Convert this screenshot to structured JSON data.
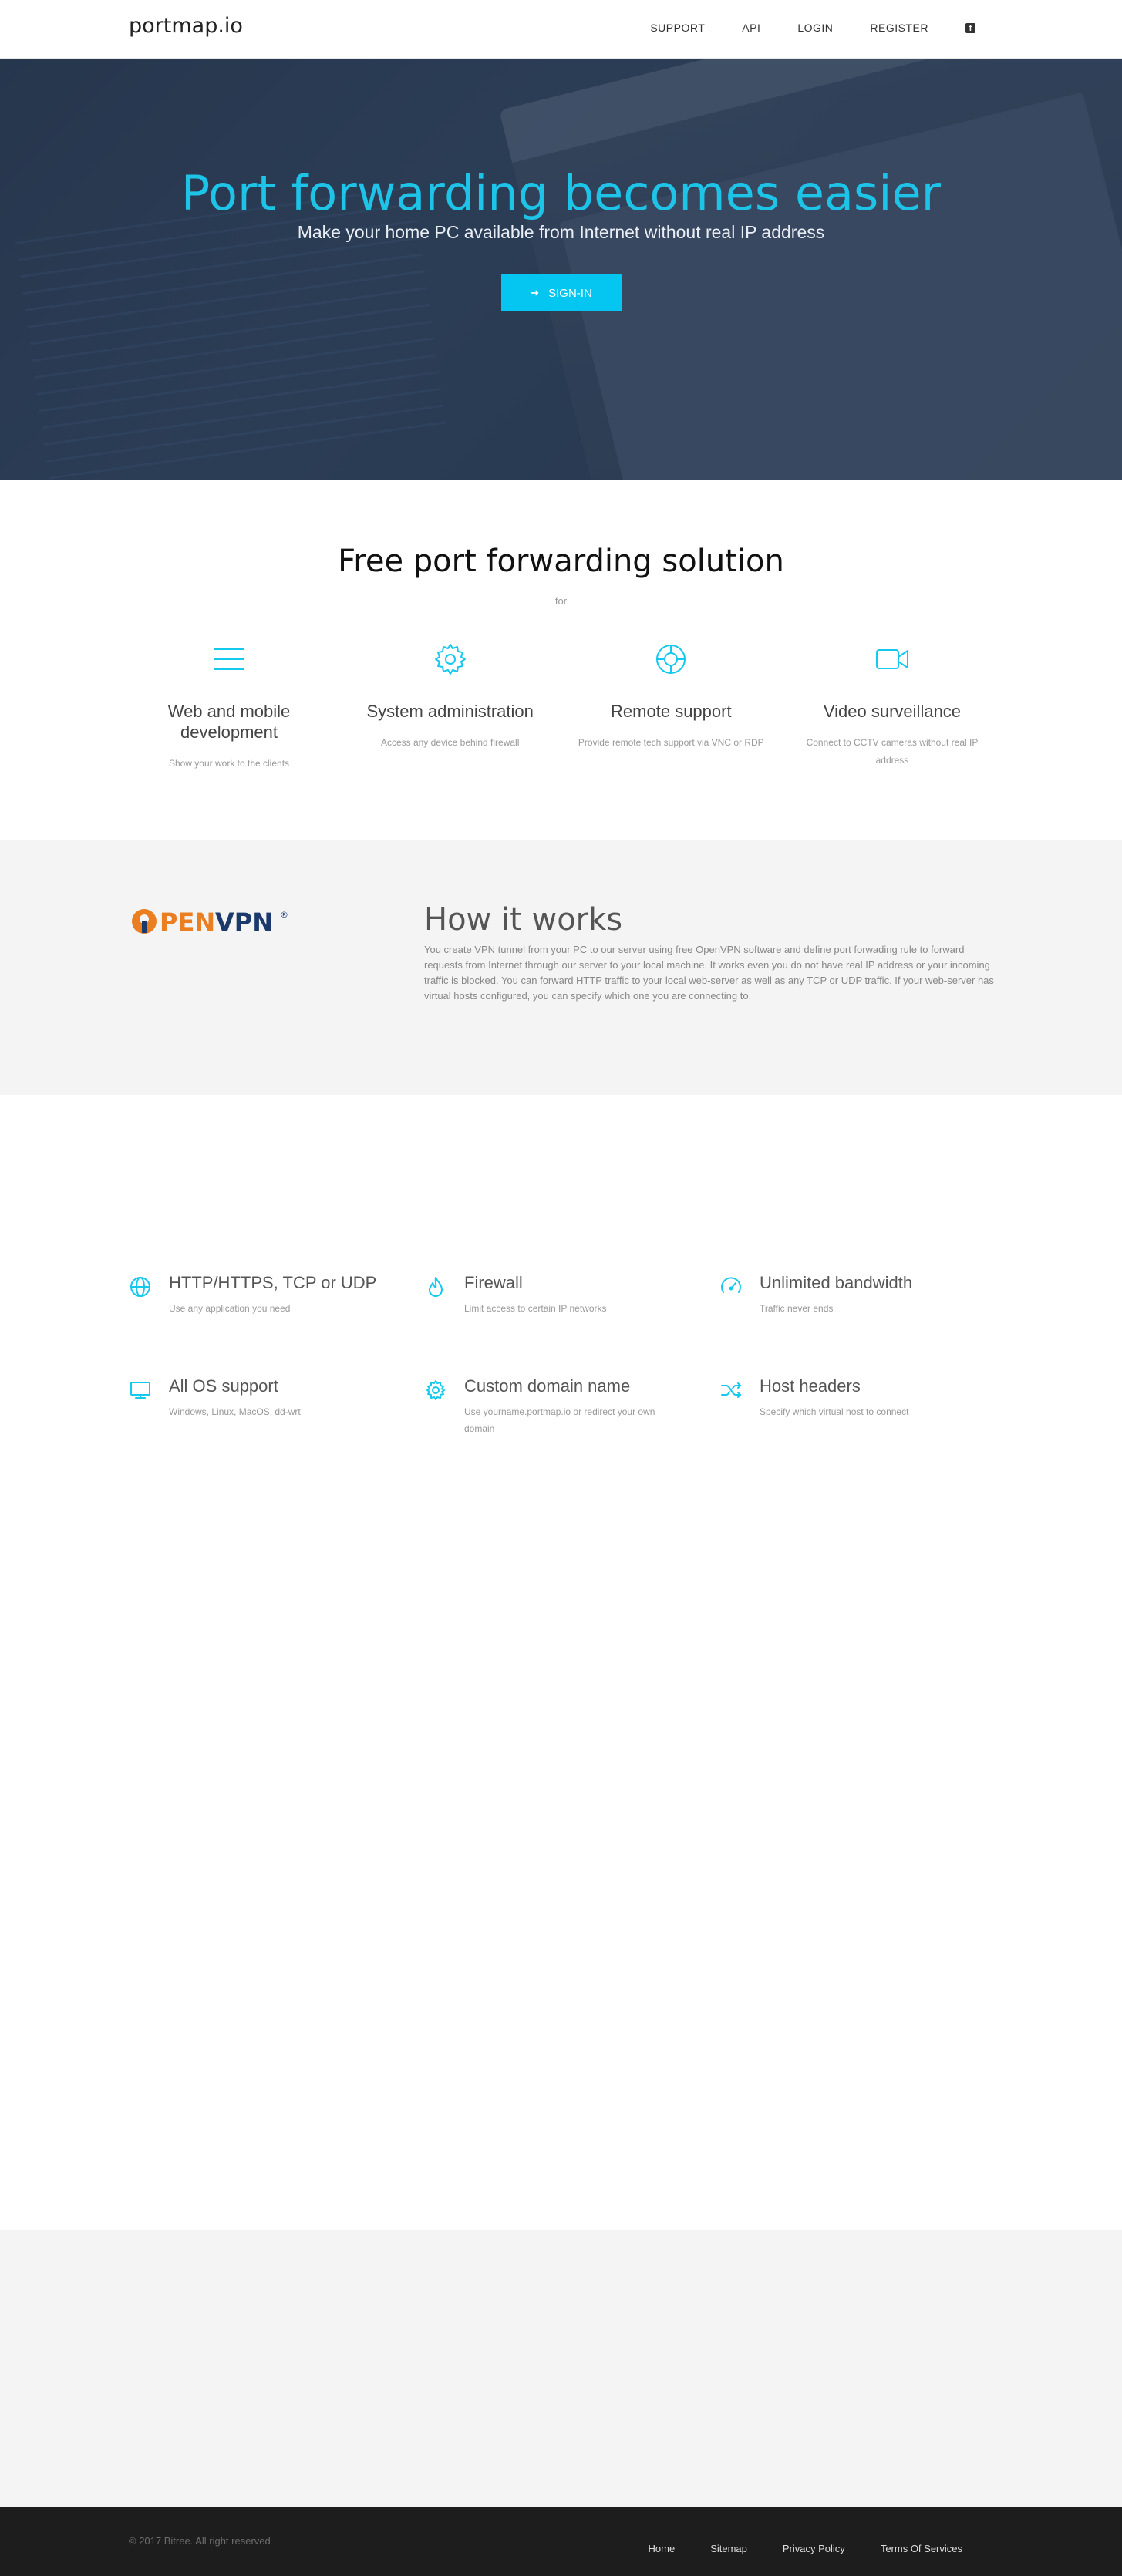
{
  "nav": {
    "brand": "portmap.io",
    "links": [
      "SUPPORT",
      "API",
      "LOGIN",
      "REGISTER"
    ],
    "facebook_glyph": "f"
  },
  "hero": {
    "title": "Port forwarding becomes easier",
    "subtitle": "Make your home PC available from Internet without real IP address",
    "button": "SIGN-IN"
  },
  "solutions": {
    "title": "Free port forwarding solution",
    "for": "for",
    "items": [
      {
        "icon": "menu-icon",
        "title": "Web and mobile development",
        "desc": "Show your work to the clients"
      },
      {
        "icon": "gear-icon",
        "title": "System administration",
        "desc": "Access any device behind firewall"
      },
      {
        "icon": "lifebuoy-icon",
        "title": "Remote support",
        "desc": "Provide remote tech support via VNC or RDP"
      },
      {
        "icon": "video-camera-icon",
        "title": "Video surveillance",
        "desc": "Connect to CCTV cameras without real IP address"
      }
    ]
  },
  "how": {
    "logo_o": "O",
    "logo_pen": "PEN",
    "logo_vpn": "VPN",
    "logo_reg": "®",
    "title": "How it works",
    "text": "You create VPN tunnel from your PC to our server using free OpenVPN software and define port forwading rule to forward requests from Internet through our server to your local machine. It works even you do not have real IP address or your incoming traffic is blocked. You can forward HTTP traffic to your local web-server as well as any TCP or UDP traffic. If your web-server has virtual hosts configured, you can specify which one you are connecting to."
  },
  "features": [
    {
      "icon": "globe-icon",
      "title": "HTTP/HTTPS, TCP or UDP",
      "desc": "Use any application you need"
    },
    {
      "icon": "flame-icon",
      "title": "Firewall",
      "desc": "Limit access to certain IP networks"
    },
    {
      "icon": "speedometer-icon",
      "title": "Unlimited bandwidth",
      "desc": "Traffic never ends"
    },
    {
      "icon": "monitor-icon",
      "title": "All OS support",
      "desc": "Windows, Linux, MacOS, dd-wrt"
    },
    {
      "icon": "gear-icon",
      "title": "Custom domain name",
      "desc": "Use yourname.portmap.io or redirect your own domain"
    },
    {
      "icon": "shuffle-icon",
      "title": "Host headers",
      "desc": "Specify which virtual host to connect"
    }
  ],
  "footer": {
    "copyright": "© 2017 Bitree. All right reserved",
    "links": [
      "Home",
      "Sitemap",
      "Privacy Policy",
      "Terms Of Services"
    ]
  },
  "colors": {
    "accent": "#05c6f0",
    "hero_bg": "#2c3b52",
    "openvpn_orange": "#ea7e20",
    "openvpn_navy": "#1b3a6b",
    "footer_bg": "#1d1d1d"
  }
}
